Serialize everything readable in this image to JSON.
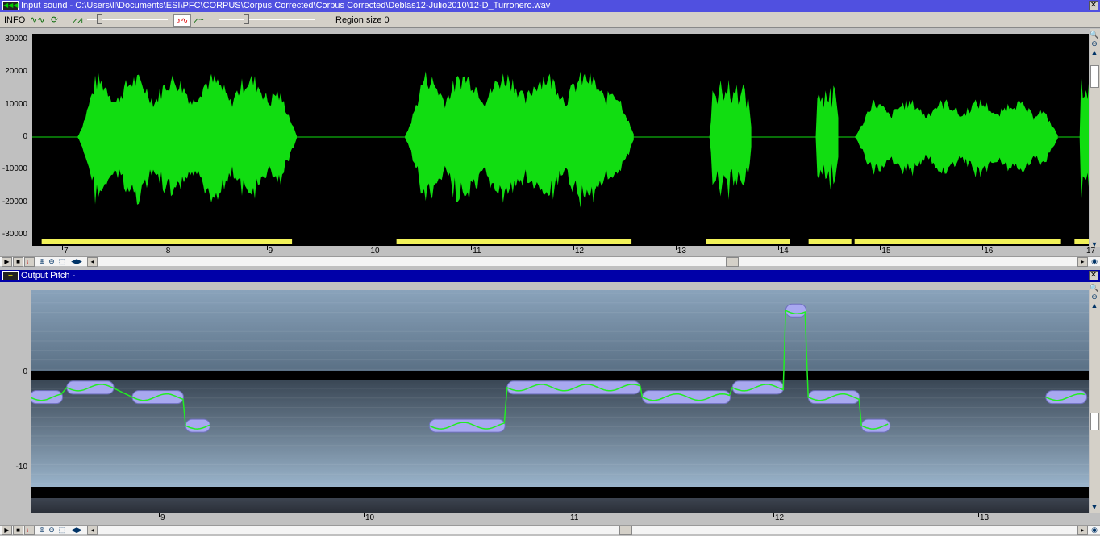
{
  "input_window": {
    "title": "Input sound - C:\\Users\\ll\\Documents\\ESI\\PFC\\CORPUS\\Corpus Corrected\\Corpus Corrected\\Deblas12-Julio2010\\12-D_Turronero.wav",
    "close": "✕"
  },
  "toolbar": {
    "info_label": "INFO",
    "region_size": "Region size 0"
  },
  "waveform": {
    "y_ticks": [
      "30000",
      "20000",
      "10000",
      "0",
      "-10000",
      "-20000",
      "-30000"
    ],
    "y_values": [
      30000,
      20000,
      10000,
      0,
      -10000,
      -20000,
      -30000
    ],
    "x_ticks": [
      "7",
      "8",
      "9",
      "10",
      "11",
      "12",
      "13",
      "14",
      "15",
      "16",
      "17"
    ],
    "x_values": [
      7,
      8,
      9,
      10,
      11,
      12,
      13,
      14,
      15,
      16,
      17
    ],
    "segments": [
      [
        7.15,
        9.3,
        20000
      ],
      [
        10.35,
        12.6,
        21000
      ],
      [
        13.33,
        13.75,
        18000
      ],
      [
        14.37,
        14.6,
        17000
      ],
      [
        14.75,
        16.75,
        12000
      ],
      [
        16.95,
        17.1,
        20000
      ]
    ],
    "regions": [
      [
        6.8,
        9.28
      ],
      [
        10.27,
        12.6
      ],
      [
        13.3,
        14.15
      ],
      [
        14.3,
        14.75
      ],
      [
        14.75,
        16.8
      ],
      [
        16.9,
        17.1
      ]
    ],
    "color": "#11dd11",
    "region_color": "#f2f25a"
  },
  "pitch_window": {
    "title": "Output Pitch -",
    "close": "✕"
  },
  "pitch": {
    "y_ticks": [
      "0",
      "-10"
    ],
    "y_values": [
      0,
      -10
    ],
    "x_ticks": [
      "9",
      "10",
      "11",
      "12",
      "13"
    ],
    "x_values": [
      9,
      10,
      11,
      12,
      13
    ],
    "notes": [
      [
        8.37,
        8.53,
        -2.6
      ],
      [
        8.55,
        8.78,
        -1.6
      ],
      [
        8.87,
        9.12,
        -2.6
      ],
      [
        9.13,
        9.25,
        -5.6
      ],
      [
        10.32,
        10.69,
        -5.6
      ],
      [
        10.7,
        11.35,
        -1.6
      ],
      [
        11.36,
        11.79,
        -2.6
      ],
      [
        11.8,
        12.05,
        -1.6
      ],
      [
        12.06,
        12.16,
        6.5
      ],
      [
        12.17,
        12.42,
        -2.6
      ],
      [
        12.43,
        12.57,
        -5.6
      ],
      [
        13.33,
        13.53,
        -2.6
      ]
    ],
    "note_color": "#a8a8f0",
    "curve_color": "#22ee22"
  }
}
